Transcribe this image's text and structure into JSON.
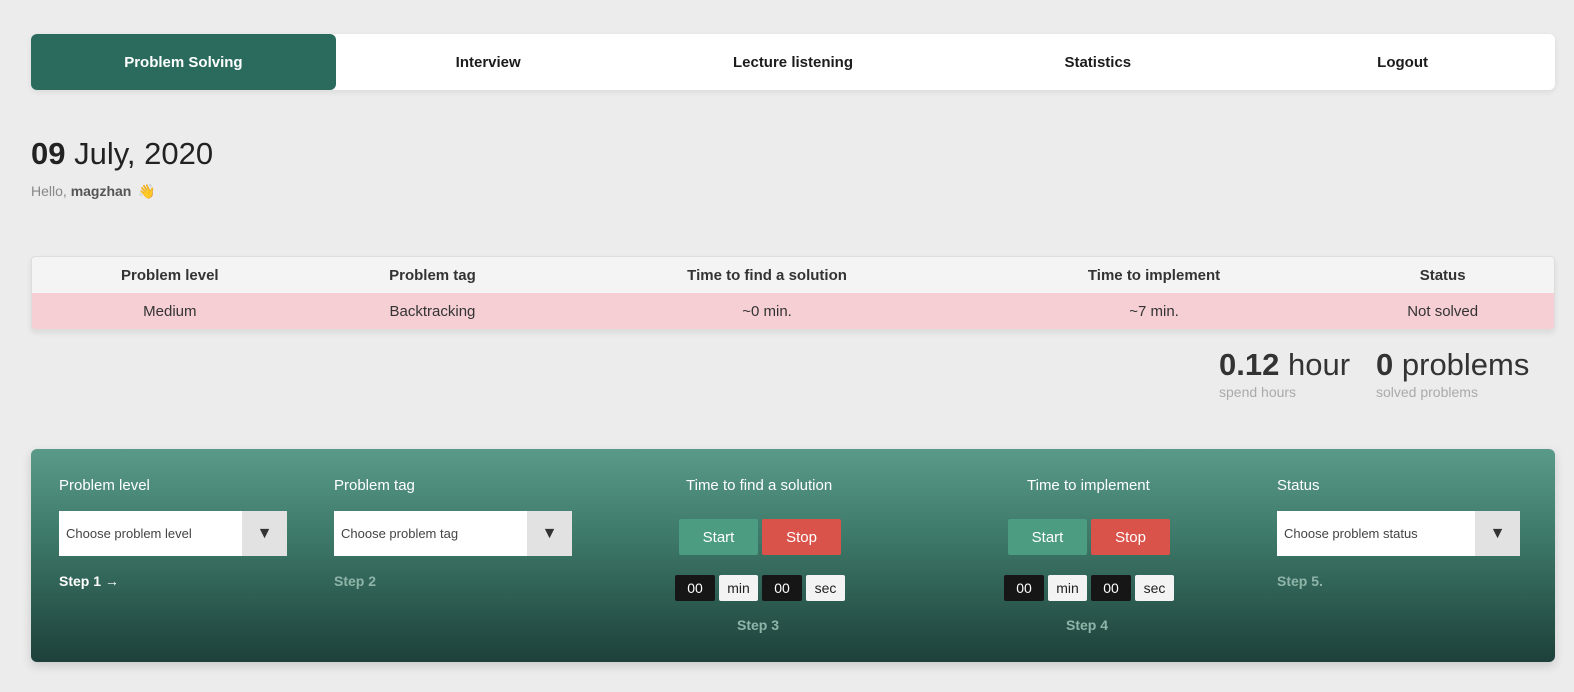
{
  "nav": {
    "items": [
      {
        "label": "Problem Solving",
        "active": true
      },
      {
        "label": "Interview",
        "active": false
      },
      {
        "label": "Lecture listening",
        "active": false
      },
      {
        "label": "Statistics",
        "active": false
      },
      {
        "label": "Logout",
        "active": false
      }
    ]
  },
  "header": {
    "day": "09",
    "month_year": "July, 2020",
    "greeting_prefix": "Hello,",
    "username": "magzhan",
    "wave": "👋"
  },
  "table": {
    "columns": [
      "Problem level",
      "Problem tag",
      "Time to find a solution",
      "Time to implement",
      "Status"
    ],
    "rows": [
      [
        "Medium",
        "Backtracking",
        "~0 min.",
        "~7 min.",
        "Not solved"
      ]
    ]
  },
  "stats": {
    "hours_value": "0.12",
    "hours_unit": "hour",
    "hours_caption": "spend hours",
    "problems_value": "0",
    "problems_unit": "problems",
    "problems_caption": "solved problems"
  },
  "form": {
    "level_label": "Problem level",
    "level_placeholder": "Choose problem level",
    "step1": "Step 1 →",
    "tag_label": "Problem tag",
    "tag_placeholder": "Choose problem tag",
    "step2": "Step 2",
    "find_label": "Time to find a solution",
    "find_start": "Start",
    "find_stop": "Stop",
    "find_min": "00",
    "find_sec": "00",
    "step3": "Step 3",
    "impl_label": "Time to implement",
    "impl_start": "Start",
    "impl_stop": "Stop",
    "impl_min": "00",
    "impl_sec": "00",
    "step4": "Step 4",
    "status_label": "Status",
    "status_placeholder": "Choose problem status",
    "step5": "Step 5.",
    "min_unit": "min",
    "sec_unit": "sec",
    "arrow": "▼"
  },
  "colors": {
    "accent": "#2a6b5e",
    "start": "#4c9c81",
    "stop": "#d9534a",
    "row_not_solved": "#f6cfd5"
  }
}
